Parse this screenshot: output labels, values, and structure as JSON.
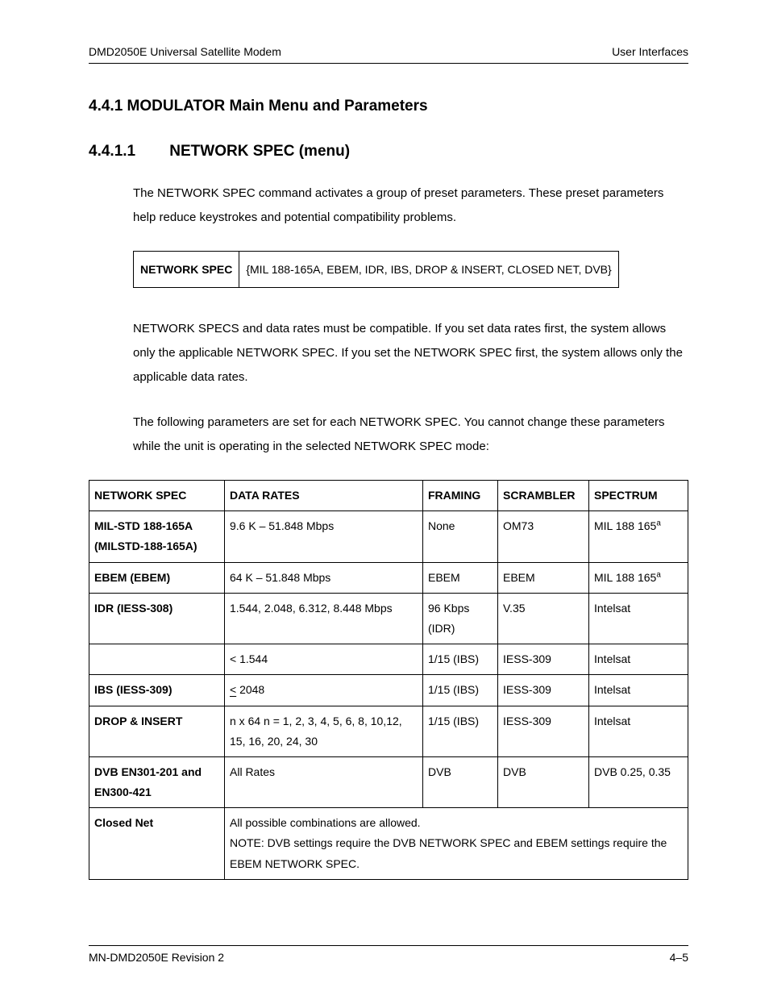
{
  "header": {
    "left": "DMD2050E Universal Satellite Modem",
    "right": "User Interfaces"
  },
  "section1": {
    "number": "4.4.1",
    "title": "MODULATOR Main Menu and Parameters"
  },
  "section2": {
    "number": "4.4.1.1",
    "title": "NETWORK SPEC (menu)"
  },
  "para1": "The NETWORK SPEC command activates a group of preset parameters.  These preset parameters help reduce keystrokes and potential compatibility problems.",
  "spec_box": {
    "label": "NETWORK SPEC",
    "value": "{MIL 188-165A, EBEM, IDR, IBS, DROP & INSERT, CLOSED NET, DVB}"
  },
  "para2": "NETWORK SPECS and data rates must be compatible.  If you set data rates first, the system allows only the applicable NETWORK SPEC. If you set the NETWORK SPEC first, the system allows only the applicable data rates.",
  "para3": "The following parameters are set for each NETWORK SPEC. You cannot change these parameters while the unit is operating in the selected NETWORK SPEC mode:",
  "table": {
    "headers": [
      "NETWORK SPEC",
      "DATA RATES",
      "FRAMING",
      "SCRAMBLER",
      "SPECTRUM"
    ],
    "rows": [
      {
        "spec": "MIL-STD 188-165A (MILSTD-188-165A)",
        "rates": "9.6 K – 51.848 Mbps",
        "framing": "None",
        "scrambler": "OM73",
        "spectrum": "MIL 188 165",
        "sup": "a"
      },
      {
        "spec": "EBEM (EBEM)",
        "rates": "64 K – 51.848 Mbps",
        "framing": "EBEM",
        "scrambler": "EBEM",
        "spectrum": "MIL 188 165",
        "sup": "a"
      },
      {
        "spec": "IDR (IESS-308)",
        "rates": "1.544, 2.048, 6.312, 8.448 Mbps",
        "framing": "96 Kbps (IDR)",
        "scrambler": "V.35",
        "spectrum": "Intelsat"
      },
      {
        "spec": "",
        "rates": "< 1.544",
        "framing": "1/15 (IBS)",
        "scrambler": "IESS-309",
        "spectrum": "Intelsat"
      },
      {
        "spec": "IBS (IESS-309)",
        "rates_underline": "<",
        "rates_after": " 2048",
        "framing": "1/15 (IBS)",
        "scrambler": "IESS-309",
        "spectrum": "Intelsat"
      },
      {
        "spec": "DROP & INSERT",
        "rates": "n x 64 n = 1, 2, 3, 4, 5, 6, 8, 10,12, 15, 16, 20, 24, 30",
        "framing": "1/15 (IBS)",
        "scrambler": "IESS-309",
        "spectrum": "Intelsat"
      },
      {
        "spec": "DVB EN301-201 and EN300-421",
        "rates": "All Rates",
        "framing": "DVB",
        "scrambler": "DVB",
        "spectrum": "DVB 0.25, 0.35"
      }
    ],
    "closed_net": {
      "label": "Closed Net",
      "line1": "All possible combinations are allowed.",
      "line2": "NOTE: DVB settings require the DVB NETWORK SPEC and EBEM settings require the EBEM NETWORK SPEC."
    }
  },
  "footer": {
    "left": "MN-DMD2050E   Revision 2",
    "right": "4–5"
  }
}
